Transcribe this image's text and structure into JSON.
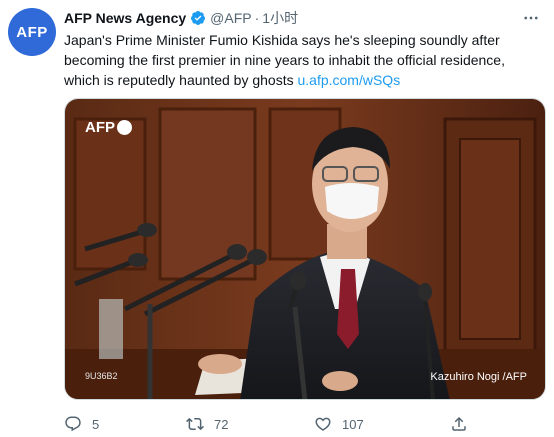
{
  "tweet": {
    "avatar_text": "AFP",
    "author_name": "AFP News Agency",
    "handle": "@AFP",
    "separator": "·",
    "time": "1小时",
    "more_icon": "more-icon",
    "body_text": "Japan's Prime Minister Fumio Kishida says he's sleeping soundly after becoming the first premier in nine years to inhabit the official residence, which is reputedly haunted by ghosts",
    "link_text": "u.afp.com/wSQs"
  },
  "media": {
    "watermark_text": "AFP",
    "photo_credit": "Kazuhiro Nogi /AFP",
    "image_code": "9U36B2",
    "accent_brand": "#2f6ad8"
  },
  "actions": {
    "reply_count": "5",
    "retweet_count": "72",
    "like_count": "107"
  },
  "colors": {
    "link": "#1d9bf0",
    "secondary_text": "#536471",
    "verified": "#1d9bf0"
  }
}
